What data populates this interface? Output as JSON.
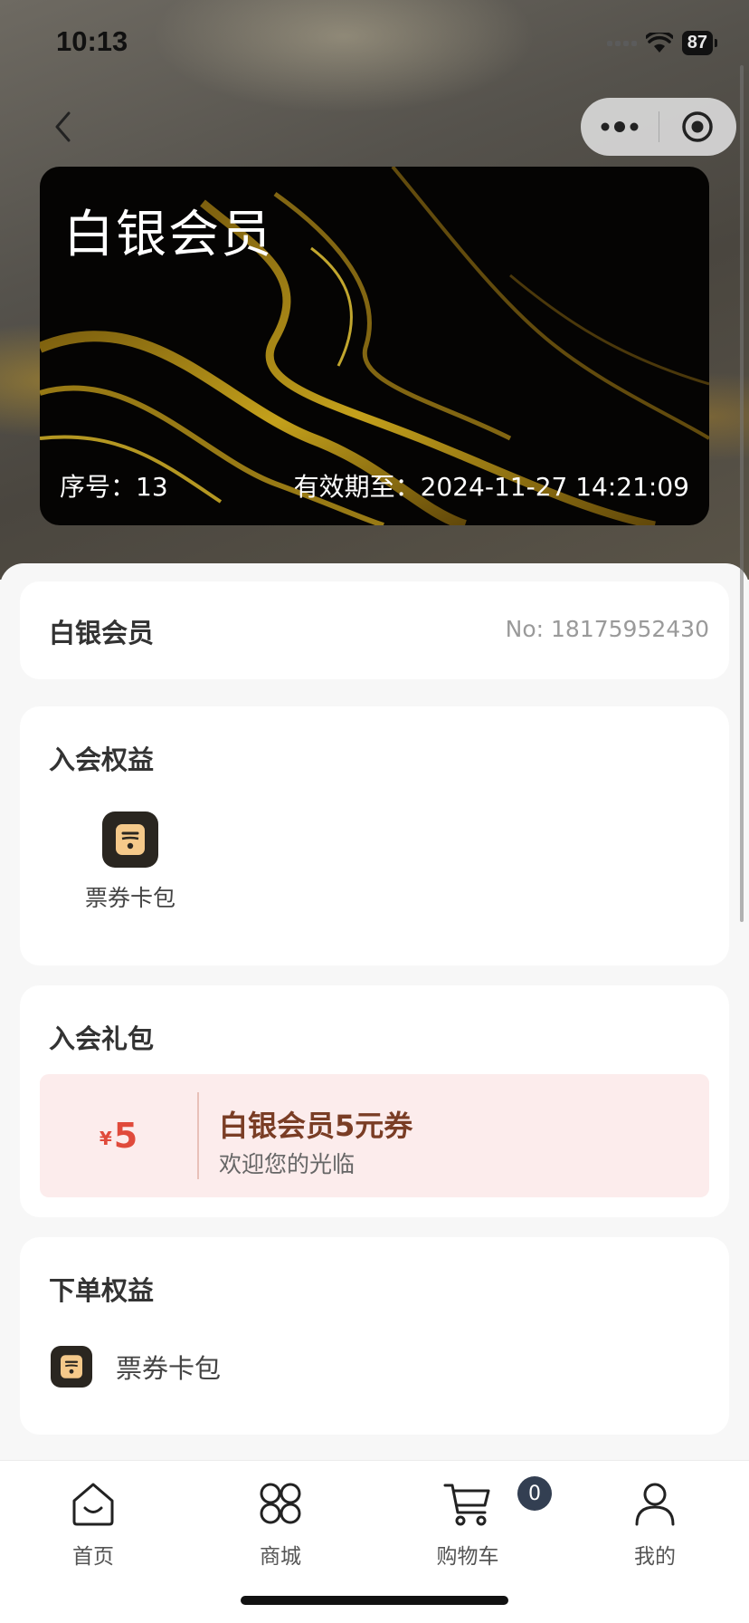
{
  "status_bar": {
    "time": "10:13",
    "battery": "87"
  },
  "nav": {
    "back_icon": "chevron-left-icon",
    "more_icon": "more-dots-icon",
    "close_icon": "target-circle-icon"
  },
  "member_card": {
    "title": "白银会员",
    "serial_label": "序号：",
    "serial_value": "13",
    "expiry_label": "有效期至：",
    "expiry_value": "2024-11-27 14:21:09"
  },
  "membership": {
    "name": "白银会员",
    "number": "No: 18175952430"
  },
  "join_benefits": {
    "title": "入会权益",
    "items": [
      {
        "label": "票券卡包",
        "icon": "coupon-wallet-icon"
      }
    ]
  },
  "join_gift": {
    "title": "入会礼包",
    "coupon": {
      "currency": "¥",
      "amount": "5",
      "name": "白银会员5元券",
      "desc": "欢迎您的光临"
    }
  },
  "order_benefits": {
    "title": "下单权益",
    "items": [
      {
        "label": "票券卡包",
        "icon": "coupon-wallet-icon"
      }
    ]
  },
  "tabbar": {
    "items": [
      {
        "label": "首页",
        "icon": "home-icon"
      },
      {
        "label": "商城",
        "icon": "grid-icon"
      },
      {
        "label": "购物车",
        "icon": "cart-icon"
      },
      {
        "label": "我的",
        "icon": "user-icon"
      }
    ],
    "cart_badge": "0"
  },
  "colors": {
    "accent": "#e04a3b",
    "coupon_bg": "#fcecec",
    "coupon_title": "#7a3d25",
    "badge": "#333f52"
  }
}
